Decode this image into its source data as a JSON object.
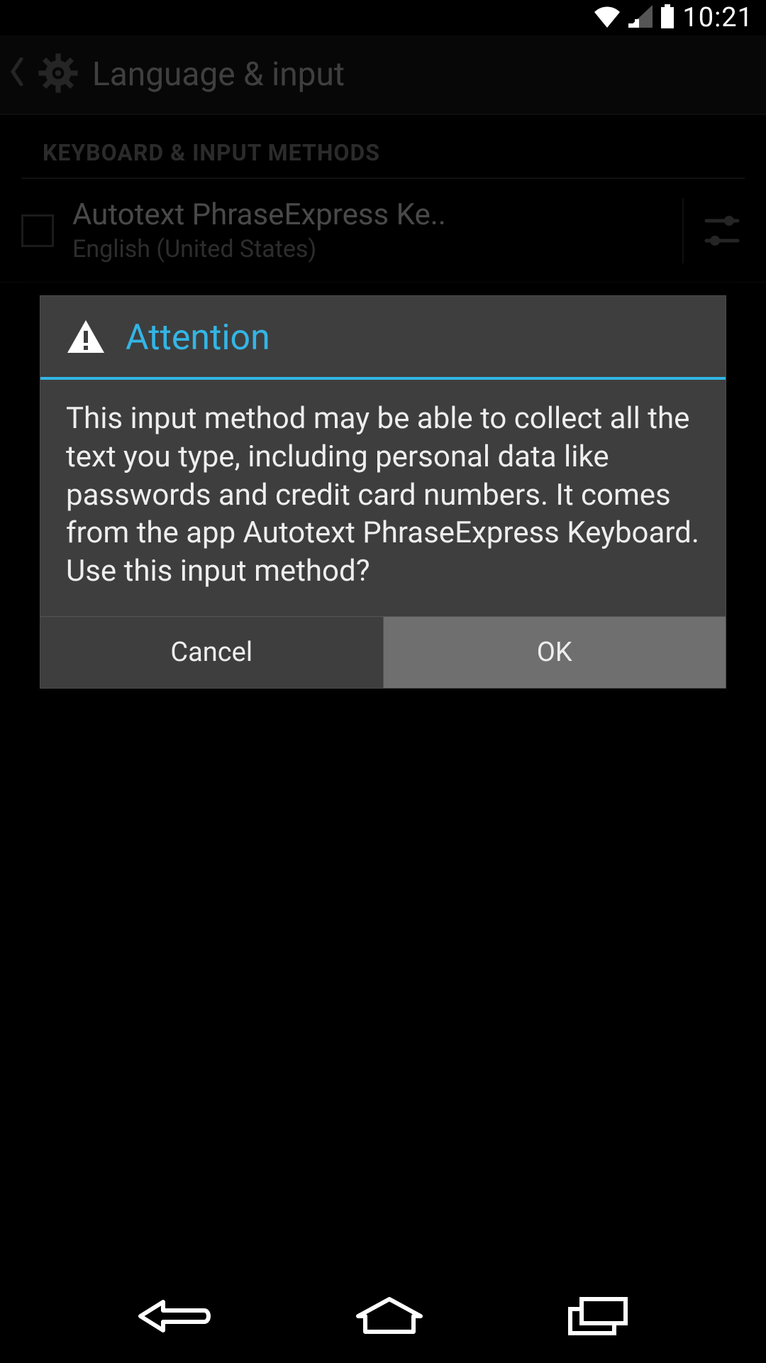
{
  "status_bar": {
    "time": "10:21"
  },
  "header": {
    "title": "Language & input"
  },
  "sections": {
    "keyboard_header": "KEYBOARD & INPUT METHODS"
  },
  "input_methods": [
    {
      "title": "Autotext PhraseExpress Ke..",
      "subtitle": "English (United States)"
    }
  ],
  "dialog": {
    "title": "Attention",
    "body": "This input method may be able to collect all the text you type, including personal data like passwords and credit card numbers. It comes from the app Autotext PhraseExpress Keyboard. Use this input method?",
    "cancel": "Cancel",
    "ok": "OK"
  },
  "colors": {
    "accent": "#33b5e5"
  }
}
